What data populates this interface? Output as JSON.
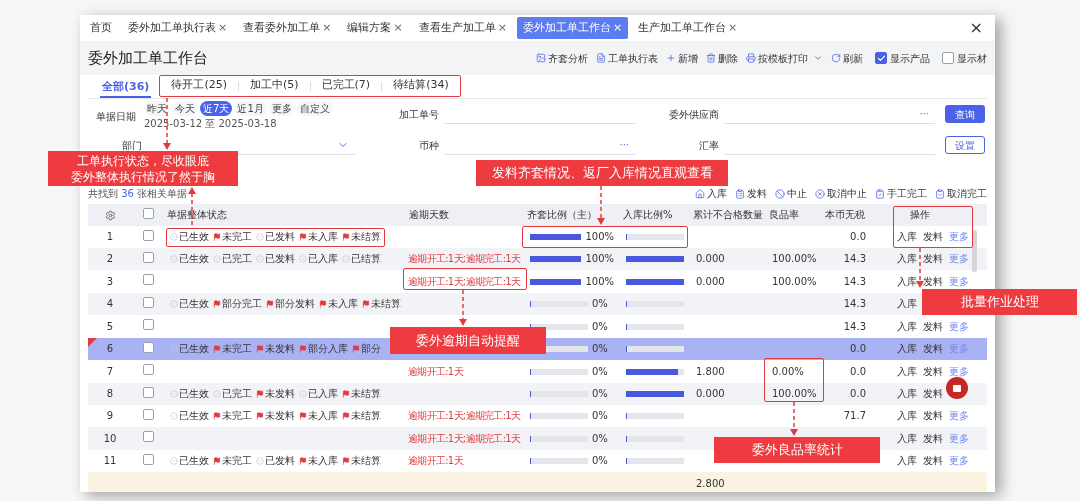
{
  "top_tabs": [
    {
      "label": "首页",
      "selected": false
    },
    {
      "label": "委外加工单执行表",
      "close": "×",
      "selected": false
    },
    {
      "label": "查看委外加工单",
      "close": "×",
      "selected": false
    },
    {
      "label": "编辑方案",
      "close": "×",
      "selected": false
    },
    {
      "label": "查看生产加工单",
      "close": "×",
      "selected": false
    },
    {
      "label": "委外加工单工作台",
      "close": "×",
      "selected": true
    },
    {
      "label": "生产加工单工作台",
      "close": "×",
      "selected": false
    }
  ],
  "window_close": "×",
  "title": "委外加工单工作台",
  "toolbar": [
    "齐套分析",
    "工单执行表",
    "新增",
    "删除",
    "按模板打印",
    "刷新"
  ],
  "toggles": [
    {
      "label": "显示产品",
      "checked": true
    },
    {
      "label": "显示材",
      "checked": false
    }
  ],
  "status_tabs": [
    {
      "label": "全部(36)",
      "selected": true
    },
    {
      "label": "待开工(25)",
      "selected": false
    },
    {
      "label": "加工中(5)",
      "selected": false
    },
    {
      "label": "已完工(7)",
      "selected": false
    },
    {
      "label": "待结算(34)",
      "selected": false
    }
  ],
  "filters": {
    "date": {
      "label": "单据日期",
      "presets": [
        {
          "label": "昨天",
          "selected": false
        },
        {
          "label": "今天",
          "selected": false
        },
        {
          "label": "近7天",
          "selected": true
        },
        {
          "label": "近1月",
          "selected": false
        },
        {
          "label": "更多",
          "selected": false
        },
        {
          "label": "自定义",
          "selected": false
        }
      ],
      "range": "2025-03-12 至 2025-03-18"
    },
    "fields": [
      {
        "label": "加工单号",
        "kind": "text"
      },
      {
        "label": "委外供应商",
        "kind": "picker",
        "picker": "···"
      },
      {
        "label": "部门",
        "kind": "select"
      },
      {
        "label": "币种",
        "kind": "picker",
        "picker": "···"
      },
      {
        "label": "汇率",
        "kind": "text"
      }
    ],
    "buttons": [
      {
        "label": "查询",
        "kind": "primary"
      },
      {
        "label": "设置",
        "kind": "outline"
      }
    ]
  },
  "result": {
    "prefix": "共找到",
    "count": "36",
    "suffix": "张相关单据"
  },
  "batch_actions": [
    "入库",
    "发料",
    "中止",
    "取消中止",
    "手工完工",
    "取消完工"
  ],
  "table": {
    "select_all": {
      "checked": false
    },
    "columns": [
      "单据整体状态",
      "逾期天数",
      "齐套比例（主）",
      "入库比例%",
      "累计不合格数量",
      "良品率",
      "本币无税",
      "操作"
    ],
    "rows": [
      {
        "no": "1",
        "selected": false,
        "checked": false,
        "marked": false,
        "status": [
          {
            "label": "已生效",
            "kind": "done"
          },
          {
            "label": "未完工",
            "kind": "flag"
          },
          {
            "label": "已发料",
            "kind": "done"
          },
          {
            "label": "未入库",
            "kind": "flag"
          },
          {
            "label": "未结算",
            "kind": "flag"
          }
        ],
        "kit": {
          "level": 1,
          "reading": "100%"
        },
        "inbound": {
          "level": 0
        },
        "amount": "0.0",
        "actions": [
          {
            "label": "入库",
            "kind": "plain"
          },
          {
            "label": "发料",
            "kind": "plain"
          },
          {
            "label": "更多",
            "kind": "link"
          }
        ]
      },
      {
        "no": "2",
        "selected": false,
        "checked": false,
        "marked": false,
        "status": [
          {
            "label": "已生效",
            "kind": "done"
          },
          {
            "label": "已完工",
            "kind": "done"
          },
          {
            "label": "已发料",
            "kind": "done"
          },
          {
            "label": "已入库",
            "kind": "done"
          },
          {
            "label": "已结算",
            "kind": "done"
          }
        ],
        "overdue": "逾期开工:1天;逾期完工:1天",
        "kit": {
          "level": 1,
          "reading": "100%"
        },
        "inbound": {
          "level": 1
        },
        "qty": "0.000",
        "yield": "100.00%",
        "amount": "14.3",
        "actions": [
          {
            "label": "入库",
            "kind": "plain"
          },
          {
            "label": "发料",
            "kind": "plain"
          },
          {
            "label": "更多",
            "kind": "link"
          }
        ]
      },
      {
        "no": "3",
        "selected": false,
        "checked": false,
        "marked": false,
        "overdue": "逾期开工:1天;逾期完工:1天",
        "kit": {
          "level": 1,
          "reading": "100%"
        },
        "inbound": {
          "level": 1
        },
        "qty": "0.000",
        "yield": "100.00%",
        "amount": "14.3",
        "actions": [
          {
            "label": "入库",
            "kind": "plain"
          },
          {
            "label": "发料",
            "kind": "plain"
          },
          {
            "label": "更多",
            "kind": "link"
          }
        ]
      },
      {
        "no": "4",
        "selected": false,
        "checked": false,
        "marked": false,
        "status": [
          {
            "label": "已生效",
            "kind": "done"
          },
          {
            "label": "部分完工",
            "kind": "flag"
          },
          {
            "label": "部分发料",
            "kind": "flag"
          },
          {
            "label": "未入库",
            "kind": "flag"
          },
          {
            "label": "未结算",
            "kind": "flag"
          }
        ],
        "kit": {
          "level": 0,
          "reading": "0%"
        },
        "inbound": {
          "level": 0
        },
        "amount": "14.3",
        "actions": [
          {
            "label": "入库",
            "kind": "plain"
          }
        ]
      },
      {
        "no": "5",
        "selected": false,
        "checked": false,
        "marked": false,
        "kit": {
          "level": 0,
          "reading": "0%"
        },
        "inbound": {
          "level": 0
        },
        "amount": "14.3",
        "actions": [
          {
            "label": "入库",
            "kind": "plain"
          },
          {
            "label": "发料",
            "kind": "plain"
          },
          {
            "label": "更多",
            "kind": "link"
          }
        ]
      },
      {
        "no": "6",
        "selected": true,
        "checked": false,
        "marked": true,
        "status": [
          {
            "label": "已生效",
            "kind": "done"
          },
          {
            "label": "未完工",
            "kind": "flag"
          },
          {
            "label": "未发料",
            "kind": "flag"
          },
          {
            "label": "部分入库",
            "kind": "flag"
          },
          {
            "label": "部分",
            "kind": "flag"
          }
        ],
        "kit": {
          "level": 0,
          "reading": "0%"
        },
        "inbound": {
          "level": 0
        },
        "amount": "0.0",
        "actions": [
          {
            "label": "入库",
            "kind": "plain"
          },
          {
            "label": "发料",
            "kind": "plain"
          },
          {
            "label": "更多",
            "kind": "link"
          }
        ]
      },
      {
        "no": "7",
        "selected": false,
        "checked": false,
        "marked": false,
        "overdue": "逾期开工:1天",
        "kit": {
          "level": 0,
          "reading": "0%"
        },
        "inbound": {
          "level": 0.9
        },
        "qty": "1.800",
        "yield": "0.00%",
        "amount": "0.0",
        "actions": [
          {
            "label": "入库",
            "kind": "plain"
          },
          {
            "label": "发料",
            "kind": "plain"
          },
          {
            "label": "更多",
            "kind": "link"
          }
        ]
      },
      {
        "no": "8",
        "selected": false,
        "checked": false,
        "marked": false,
        "status": [
          {
            "label": "已生效",
            "kind": "done"
          },
          {
            "label": "已完工",
            "kind": "done"
          },
          {
            "label": "未发料",
            "kind": "flag"
          },
          {
            "label": "已入库",
            "kind": "done"
          },
          {
            "label": "未结算",
            "kind": "flag"
          }
        ],
        "kit": {
          "level": 0,
          "reading": "0%"
        },
        "inbound": {
          "level": 1
        },
        "qty": "0.000",
        "yield": "100.00%",
        "amount": "0.0",
        "actions": [
          {
            "label": "入库",
            "kind": "plain"
          },
          {
            "label": "发料",
            "kind": "plain"
          }
        ]
      },
      {
        "no": "9",
        "selected": false,
        "checked": false,
        "marked": false,
        "status": [
          {
            "label": "已生效",
            "kind": "done"
          },
          {
            "label": "未完工",
            "kind": "flag"
          },
          {
            "label": "未发料",
            "kind": "flag"
          },
          {
            "label": "未入库",
            "kind": "flag"
          },
          {
            "label": "未结算",
            "kind": "flag"
          }
        ],
        "overdue": "逾期开工:1天;逾期完工:1天",
        "kit": {
          "level": 0,
          "reading": "0%"
        },
        "inbound": {
          "level": 0
        },
        "amount": "71.7",
        "actions": [
          {
            "label": "入库",
            "kind": "plain"
          },
          {
            "label": "发料",
            "kind": "plain"
          },
          {
            "label": "更多",
            "kind": "link"
          }
        ]
      },
      {
        "no": "10",
        "selected": false,
        "checked": false,
        "marked": false,
        "overdue": "逾期开工:1天;逾期完工:1天",
        "kit": {
          "level": 0,
          "reading": "0%"
        },
        "inbound": {
          "level": 0
        },
        "actions": [
          {
            "label": "入库",
            "kind": "plain"
          },
          {
            "label": "发料",
            "kind": "plain"
          },
          {
            "label": "更多",
            "kind": "link"
          }
        ]
      },
      {
        "no": "11",
        "selected": false,
        "checked": false,
        "marked": false,
        "status": [
          {
            "label": "已生效",
            "kind": "done"
          },
          {
            "label": "未完工",
            "kind": "flag"
          },
          {
            "label": "已发料",
            "kind": "done"
          },
          {
            "label": "未入库",
            "kind": "flag"
          },
          {
            "label": "未结算",
            "kind": "flag"
          }
        ],
        "overdue": "逾期开工:1天",
        "kit": {
          "level": 0,
          "reading": "0%"
        },
        "inbound": {
          "level": 0
        },
        "actions": [
          {
            "label": "入库",
            "kind": "plain"
          },
          {
            "label": "发料",
            "kind": "plain"
          },
          {
            "label": "更多",
            "kind": "link"
          }
        ]
      }
    ],
    "footer": {
      "qty": "2.800"
    }
  },
  "callouts": [
    {
      "lines": [
        "工单执行状态，尽收眼底",
        "委外整体执行情况了然于胸"
      ]
    },
    {
      "lines": [
        "发料齐套情况、返厂入库情况直观查看"
      ]
    },
    {
      "lines": [
        "委外逾期自动提醒"
      ]
    },
    {
      "lines": [
        "批量作业处理"
      ]
    },
    {
      "lines": [
        "委外良品率统计"
      ]
    }
  ]
}
